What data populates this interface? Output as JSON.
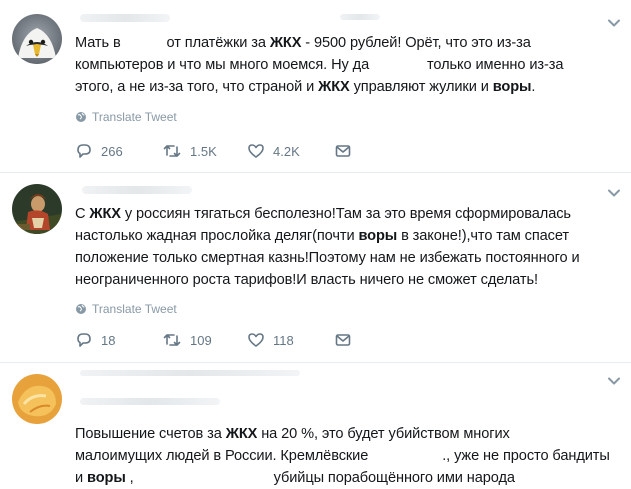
{
  "tweets": [
    {
      "text": {
        "p1": "Мать в ",
        "p2": " от платёжки за ",
        "p3": "ЖКХ",
        "p4": " - 9500 рублей! Орёт, что это из-за",
        "p5": "компьютеров и что мы много моемся. Ну да ",
        "p6": " только именно из-за",
        "p7": "этого, а не из-за того, что страной и ",
        "p8": "ЖКХ",
        "p9": " управляют жулики и ",
        "p10": "воры",
        "p11": "."
      },
      "translate_label": "Translate Tweet",
      "counts": {
        "replies": "266",
        "retweets": "1.5K",
        "likes": "4.2K"
      }
    },
    {
      "text": {
        "p1": "С ",
        "p2": "ЖКХ",
        "p3": " у россиян тягаться бесполезно!Там за это время сформировалась",
        "p4": "настолько жадная прослойка деляг(почти ",
        "p5": "воры",
        "p6": " в законе!),что там спасет",
        "p7": "положение только смертная казнь!Поэтому нам не избежать постоянного и",
        "p8": "неограниченного роста тарифов!И власть ничего не сможет сделать!"
      },
      "translate_label": "Translate Tweet",
      "counts": {
        "replies": "18",
        "retweets": "109",
        "likes": "118"
      }
    },
    {
      "text": {
        "p1": "Повышение счетов за ",
        "p2": "ЖКХ",
        "p3": " на 20 %, это будет убийством многих",
        "p4": "малоимущих людей в России. Кремлёвские ",
        "p5": "., уже не просто бандиты",
        "p6": "и ",
        "p7": "воры",
        "p8": " ,",
        "p9": "убийцы порабощённого ими народа"
      }
    }
  ],
  "icons": [
    "chevron-down-icon",
    "globe-icon",
    "reply-icon",
    "retweet-icon",
    "like-icon",
    "dm-icon"
  ],
  "colors": {
    "muted": "#657786",
    "icon": "#8899a6",
    "divider": "#e6ecf0",
    "text": "#14171a"
  }
}
